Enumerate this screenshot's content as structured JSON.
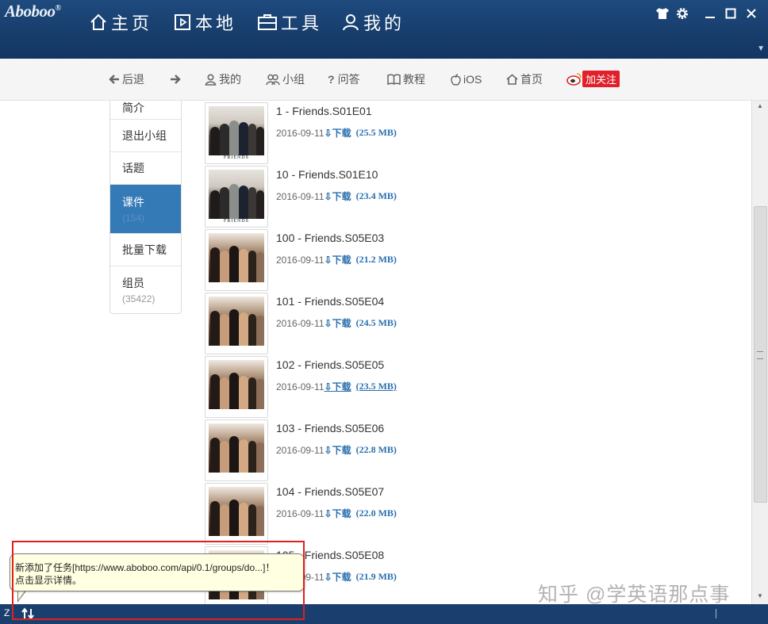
{
  "app": {
    "logo": "Aboboo",
    "logo_reg": "®",
    "nav_tabs": [
      {
        "label": "主页",
        "icon": "home-icon"
      },
      {
        "label": "本地",
        "icon": "film-icon"
      },
      {
        "label": "工具",
        "icon": "toolbox-icon"
      },
      {
        "label": "我的",
        "icon": "user-icon"
      }
    ],
    "window_controls": [
      "shirt-icon",
      "gear-icon",
      "minimize-icon",
      "maximize-icon",
      "close-icon"
    ],
    "collapse_glyph": "▼"
  },
  "toolbar": {
    "back": "后退",
    "items": [
      {
        "label": "我的",
        "icon": "person-icon"
      },
      {
        "label": "小组",
        "icon": "group-icon"
      },
      {
        "label": "问答",
        "icon": "question-icon"
      },
      {
        "label": "教程",
        "icon": "book-icon"
      },
      {
        "label": "iOS",
        "icon": "apple-icon"
      },
      {
        "label": "首页",
        "icon": "home-icon"
      }
    ],
    "weibo_label": "加关注"
  },
  "sidebar": {
    "items": [
      {
        "label": "简介"
      },
      {
        "label": "退出小组"
      },
      {
        "label": "话题"
      },
      {
        "label": "课件",
        "count": "(154)",
        "active": true
      },
      {
        "label": "批量下载"
      },
      {
        "label": "组员",
        "count": "(35422)"
      }
    ]
  },
  "courses": [
    {
      "title": "1 - Friends.S01E01",
      "date": "2016-09-11",
      "download": "下载",
      "size": "(25.5 MB)"
    },
    {
      "title": "10 - Friends.S01E10",
      "date": "2016-09-11",
      "download": "下载",
      "size": "(23.4 MB)"
    },
    {
      "title": "100 - Friends.S05E03",
      "date": "2016-09-11",
      "download": "下载",
      "size": "(21.2 MB)"
    },
    {
      "title": "101 - Friends.S05E04",
      "date": "2016-09-11",
      "download": "下载",
      "size": "(24.5 MB)"
    },
    {
      "title": "102 - Friends.S05E05",
      "date": "2016-09-11",
      "download": "下载",
      "size": "(23.5 MB)"
    },
    {
      "title": "103 - Friends.S05E06",
      "date": "2016-09-11",
      "download": "下载",
      "size": "(22.8 MB)"
    },
    {
      "title": "104 - Friends.S05E07",
      "date": "2016-09-11",
      "download": "下载",
      "size": "(22.0 MB)"
    },
    {
      "title": "105 - Friends.S05E08",
      "date": "2016-09-11",
      "download": "下载",
      "size": "(21.9 MB)"
    }
  ],
  "thumb_caption": "FRIENDS",
  "tooltip": {
    "line1": "新添加了任务[https://www.aboboo.com/api/0.1/groups/do...]！",
    "line2": "点击显示详情。"
  },
  "watermark": "知乎 @学英语那点事",
  "status": {
    "left_text": "Z"
  }
}
